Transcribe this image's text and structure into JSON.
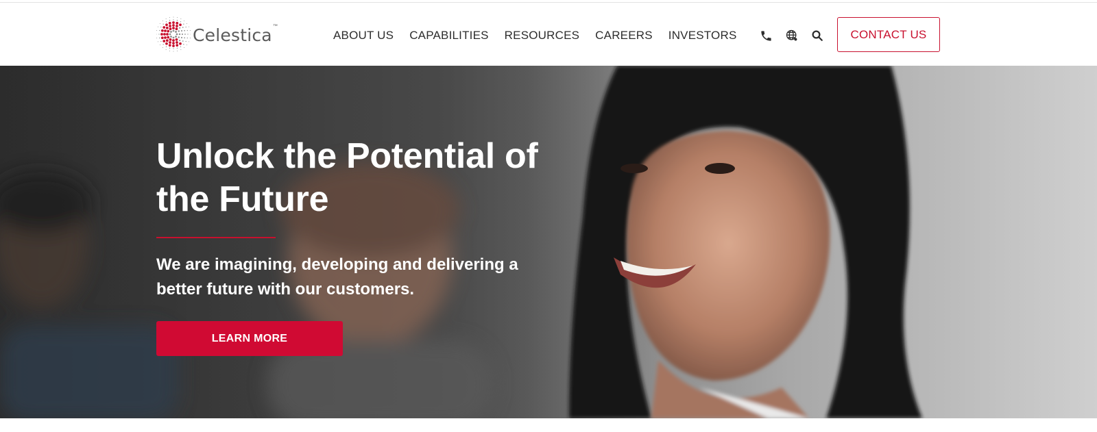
{
  "brand": {
    "name": "Celestica",
    "trademark": "™",
    "accent_color": "#c8102e"
  },
  "nav": {
    "items": [
      {
        "label": "ABOUT US"
      },
      {
        "label": "CAPABILITIES"
      },
      {
        "label": "RESOURCES"
      },
      {
        "label": "CAREERS"
      },
      {
        "label": "INVESTORS"
      }
    ]
  },
  "utility_icons": [
    "phone-icon",
    "globe-icon",
    "search-icon"
  ],
  "header": {
    "contact_label": "CONTACT US"
  },
  "hero": {
    "title": "Unlock the Potential of the Future",
    "subtitle": "We are imagining, developing and delivering a better future with our customers.",
    "cta_label": "LEARN MORE",
    "cta_color": "#d00a33"
  }
}
